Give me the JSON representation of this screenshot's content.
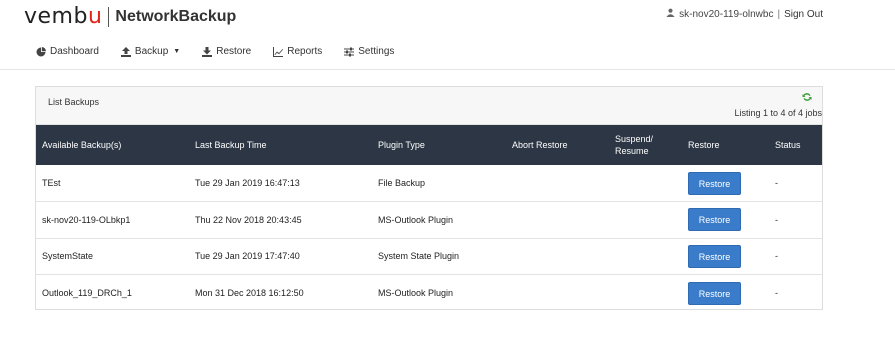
{
  "brand": {
    "logo_prefix": "vemb",
    "logo_u": "u",
    "product": "NetworkBackup"
  },
  "user": {
    "name": "sk-nov20-119-olnwbc",
    "separator": "|",
    "signout_label": "Sign Out"
  },
  "nav": {
    "dashboard": "Dashboard",
    "backup": "Backup",
    "restore": "Restore",
    "reports": "Reports",
    "settings": "Settings"
  },
  "panel": {
    "title": "List Backups",
    "listing_text": "Listing 1 to 4 of 4 jobs"
  },
  "table": {
    "headers": {
      "available": "Available Backup(s)",
      "last_time": "Last Backup Time",
      "plugin": "Plugin Type",
      "abort": "Abort Restore",
      "suspend_line1": "Suspend/",
      "suspend_line2": "Resume",
      "restore": "Restore",
      "status": "Status"
    },
    "rows": [
      {
        "name": "TEst",
        "time": "Tue 29 Jan 2019 16:47:13",
        "plugin": "File Backup",
        "abort": "",
        "suspend": "",
        "restore_label": "Restore",
        "status": "-"
      },
      {
        "name": "sk-nov20-119-OLbkp1",
        "time": "Thu 22 Nov 2018 20:43:45",
        "plugin": "MS-Outlook Plugin",
        "abort": "",
        "suspend": "",
        "restore_label": "Restore",
        "status": "-"
      },
      {
        "name": "SystemState",
        "time": "Tue 29 Jan 2019 17:47:40",
        "plugin": "System State Plugin",
        "abort": "",
        "suspend": "",
        "restore_label": "Restore",
        "status": "-"
      },
      {
        "name": "Outlook_119_DRCh_1",
        "time": "Mon 31 Dec 2018 16:12:50",
        "plugin": "MS-Outlook Plugin",
        "abort": "",
        "suspend": "",
        "restore_label": "Restore",
        "status": "-"
      }
    ]
  },
  "colors": {
    "header_row": "#2c3644",
    "button": "#3a7cc9",
    "refresh": "#3a9d3a",
    "logo_accent": "#e2231a"
  }
}
